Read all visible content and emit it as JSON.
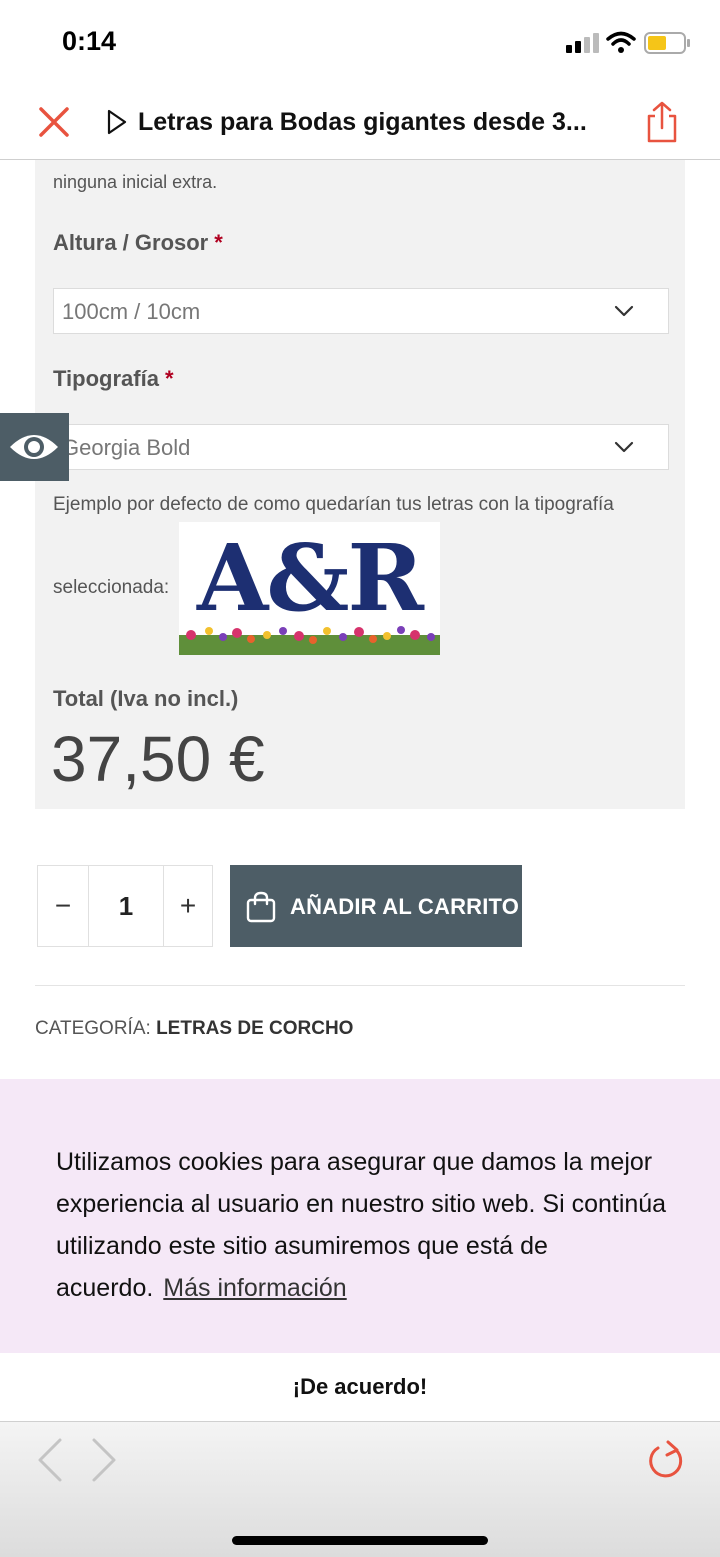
{
  "status_bar": {
    "time": "0:14"
  },
  "browser": {
    "title": "Letras para Bodas gigantes desde 3...",
    "accent_color": "#e8533f"
  },
  "form": {
    "note": "ninguna inicial extra.",
    "height_label": "Altura / Grosor",
    "height_value": "100cm / 10cm",
    "font_label": "Tipografía",
    "font_value": "Georgia Bold",
    "required_mark": "*",
    "example_text": "Ejemplo por defecto de como quedarían tus letras con la tipografía",
    "selected_text": "seleccionada:",
    "sample_letters": "A&R",
    "total_label": "Total (Iva no incl.)",
    "total_price": "37,50 €"
  },
  "cart": {
    "minus": "−",
    "quantity": "1",
    "plus": "+",
    "add_label": "AÑADIR AL CARRITO",
    "button_color": "#4d5d66"
  },
  "category": {
    "label": "CATEGORÍA:",
    "value": "LETRAS DE CORCHO"
  },
  "cookie": {
    "text": "Utilizamos cookies para asegurar que damos la mejor experiencia al usuario en nuestro sitio web. Si continúa utilizando este sitio asumiremos que está de acuerdo.",
    "link": "Más información",
    "accept": "¡De acuerdo!",
    "background": "#f5e8f7"
  },
  "icons": [
    "close-icon",
    "play-icon",
    "share-icon",
    "eye-icon",
    "chevron-down-icon",
    "bag-icon",
    "back-icon",
    "forward-icon",
    "reload-icon"
  ]
}
